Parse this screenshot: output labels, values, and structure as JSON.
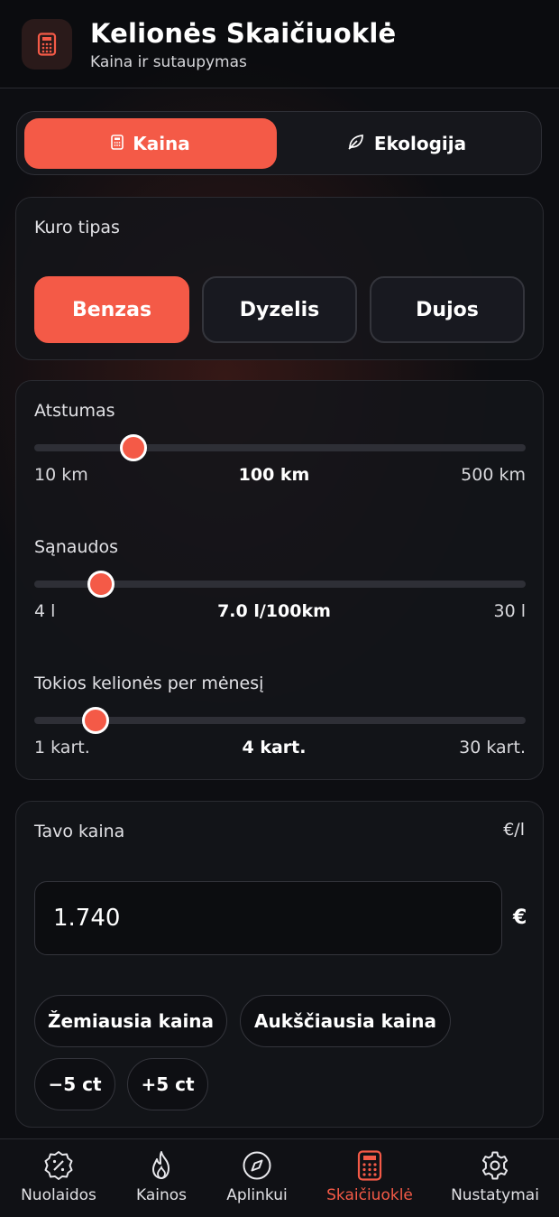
{
  "header": {
    "title": "Kelionės Skaičiuoklė",
    "subtitle": "Kaina ir sutaupymas",
    "icon": "calculator-icon"
  },
  "tabs": [
    {
      "label": "Kaina",
      "icon": "calculator-icon",
      "active": true
    },
    {
      "label": "Ekologija",
      "icon": "leaf-icon",
      "active": false
    }
  ],
  "fuel": {
    "label": "Kuro tipas",
    "options": [
      "Benzas",
      "Dyzelis",
      "Dujos"
    ],
    "selected": "Benzas"
  },
  "sliders": {
    "distance": {
      "label": "Atstumas",
      "min_label": "10 km",
      "value_label": "100 km",
      "max_label": "500 km",
      "min": 10,
      "max": 500,
      "value": 100
    },
    "consumption": {
      "label": "Sąnaudos",
      "min_label": "4 l",
      "value_label": "7.0 l/100km",
      "max_label": "30 l",
      "min": 4,
      "max": 30,
      "value": 7.0
    },
    "trips": {
      "label": "Tokios kelionės per mėnesį",
      "min_label": "1 kart.",
      "value_label": "4 kart.",
      "max_label": "30 kart.",
      "min": 1,
      "max": 30,
      "value": 4
    }
  },
  "price": {
    "label": "Tavo kaina",
    "unit": "€/l",
    "value": "1.740",
    "currency": "€",
    "chips": {
      "lowest": "Žemiausia kaina",
      "highest": "Aukščiausia kaina",
      "minus": "−5 ct",
      "plus": "+5 ct"
    }
  },
  "nav": [
    {
      "label": "Nuolaidos",
      "icon": "discount-badge-icon",
      "active": false
    },
    {
      "label": "Kainos",
      "icon": "flame-icon",
      "active": false
    },
    {
      "label": "Aplinkui",
      "icon": "compass-icon",
      "active": false
    },
    {
      "label": "Skaičiuoklė",
      "icon": "calculator-icon",
      "active": true
    },
    {
      "label": "Nustatymai",
      "icon": "gear-icon",
      "active": false
    }
  ],
  "colors": {
    "accent": "#f45a47",
    "background": "#0d0e12"
  }
}
